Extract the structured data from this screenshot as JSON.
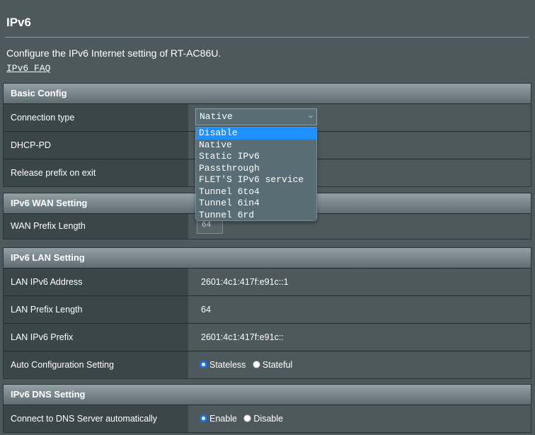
{
  "page": {
    "title": "IPv6",
    "description": "Configure the IPv6 Internet setting of RT-AC86U.",
    "faq_link": "IPv6 FAQ"
  },
  "basic_config": {
    "header": "Basic Config",
    "connection_type_label": "Connection type",
    "connection_type_value": "Native",
    "dhcp_pd_label": "DHCP-PD",
    "release_prefix_label": "Release prefix on exit",
    "dropdown_options": [
      "Disable",
      "Native",
      "Static IPv6",
      "Passthrough",
      "FLET'S IPv6 service",
      "Tunnel 6to4",
      "Tunnel 6in4",
      "Tunnel 6rd"
    ],
    "dropdown_highlighted": "Disable"
  },
  "wan_setting": {
    "header": "IPv6 WAN Setting",
    "prefix_length_label": "WAN Prefix Length",
    "prefix_length_value": "64"
  },
  "lan_setting": {
    "header": "IPv6 LAN Setting",
    "address_label": "LAN IPv6 Address",
    "address_value": "2601:4c1:417f:e91c::1",
    "prefix_length_label": "LAN Prefix Length",
    "prefix_length_value": "64",
    "prefix_label": "LAN IPv6 Prefix",
    "prefix_value": "2601:4c1:417f:e91c::",
    "auto_config_label": "Auto Configuration Setting",
    "auto_config_options": [
      "Stateless",
      "Stateful"
    ],
    "auto_config_selected": "Stateless"
  },
  "dns_setting": {
    "header": "IPv6 DNS Setting",
    "auto_dns_label": "Connect to DNS Server automatically",
    "auto_dns_options": [
      "Enable",
      "Disable"
    ],
    "auto_dns_selected": "Enable"
  },
  "colors": {
    "background": "#4d595d",
    "label_column": "#3b464a",
    "highlight": "#1e90ff",
    "radio_checked": "#1a73e8"
  }
}
